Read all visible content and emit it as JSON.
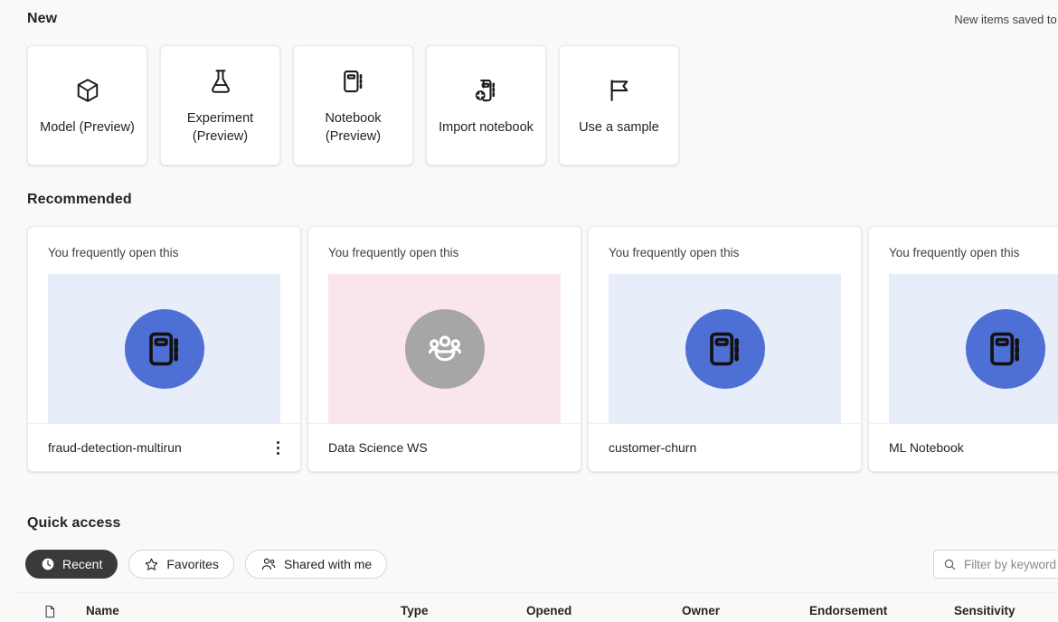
{
  "header": {
    "new_title": "New",
    "saved_to": "New items saved to :"
  },
  "new_items": [
    {
      "label": "Model (Preview)",
      "icon": "cube-icon"
    },
    {
      "label": "Experiment (Preview)",
      "icon": "flask-icon"
    },
    {
      "label": "Notebook (Preview)",
      "icon": "notebook-icon"
    },
    {
      "label": "Import notebook",
      "icon": "notebook-add-icon"
    },
    {
      "label": "Use a sample",
      "icon": "flag-icon"
    }
  ],
  "recommended": {
    "title": "Recommended",
    "cards": [
      {
        "subtitle": "You frequently open this",
        "name": "fraud-detection-multirun",
        "thumb": "blue",
        "icon": "notebook-icon",
        "has_menu": true
      },
      {
        "subtitle": "You frequently open this",
        "name": "Data Science WS",
        "thumb": "pink",
        "icon": "people-icon",
        "has_menu": false
      },
      {
        "subtitle": "You frequently open this",
        "name": "customer-churn",
        "thumb": "blue",
        "icon": "notebook-icon",
        "has_menu": false
      },
      {
        "subtitle": "You frequently open this",
        "name": "ML Notebook",
        "thumb": "blue",
        "icon": "notebook-icon",
        "has_menu": false
      }
    ]
  },
  "quick_access": {
    "title": "Quick access",
    "tabs": [
      {
        "label": "Recent",
        "icon": "clock-icon",
        "active": true
      },
      {
        "label": "Favorites",
        "icon": "star-icon",
        "active": false
      },
      {
        "label": "Shared with me",
        "icon": "people-icon",
        "active": false
      }
    ],
    "filter_placeholder": "Filter by keyword",
    "columns": [
      "Name",
      "Type",
      "Opened",
      "Owner",
      "Endorsement",
      "Sensitivity"
    ]
  },
  "colors": {
    "page_bg": "#faf9f8",
    "card_bg": "#ffffff",
    "accent_blue": "#4e6fd4",
    "thumb_blue": "#e8edfa",
    "thumb_pink": "#fae5ee",
    "bubble_gray": "#a6a6a6",
    "pill_active_bg": "#3b3a39"
  }
}
